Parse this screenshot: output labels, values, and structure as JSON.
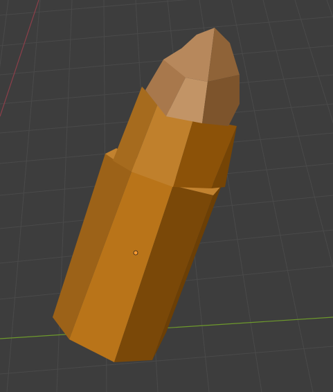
{
  "viewport": {
    "view": "3d-viewport-perspective",
    "background_color": "#3d3d3d",
    "grid_line_color": "#4a4a4a",
    "axis_x_color": "#8c3f4a",
    "axis_y_color": "#6e9a2c"
  },
  "object": {
    "kind": "lipstick-mesh",
    "base_color": "#c07d2a",
    "tip_color": "#b98a5f",
    "origin_color": "#ff9a2f",
    "selected": false
  }
}
